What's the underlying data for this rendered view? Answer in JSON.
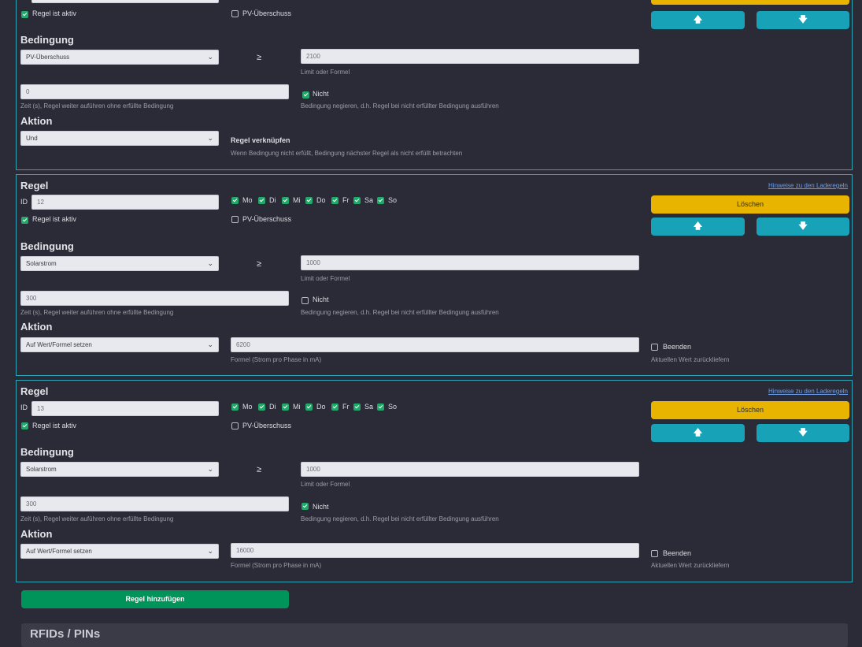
{
  "labels": {
    "rule_heading": "Regel",
    "id_label": "ID",
    "rule_active": "Regel ist aktiv",
    "pv_surplus": "PV-Überschuss",
    "condition_heading": "Bedingung",
    "operator": "≥",
    "limit_hint": "Limit oder Formel",
    "time_hint": "Zeit (s), Regel weiter auführen ohne erfüllte Bedingung",
    "negate_label": "Nicht",
    "negate_hint": "Bedingung negieren, d.h. Regel bei nicht erfüllter Bedingung ausführen",
    "action_heading": "Aktion",
    "link_rules": "Regel verknüpfen",
    "link_rules_hint": "Wenn Bedingung nicht erfüllt, Bedingung nächster Regel als nicht erfüllt betrachten",
    "formula_hint": "Formel (Strom pro Phase in mA)",
    "finish_label": "Beenden",
    "finish_hint": "Aktuellen Wert zurückliefern",
    "delete": "Löschen",
    "help_link": "Hinweise zu den Laderegeln",
    "add_rule": "Regel hinzufügen",
    "section_title": "RFIDs / PINs",
    "arrow_up": "🡅",
    "arrow_down": "🡇"
  },
  "days": [
    "Mo",
    "Di",
    "Mi",
    "Do",
    "Fr",
    "Sa",
    "So"
  ],
  "rule1": {
    "active": true,
    "pv_surplus": false,
    "condition": "PV-Überschuss",
    "limit": "2100",
    "time": "0",
    "negate": true,
    "action": "Und"
  },
  "rule2": {
    "id": "12",
    "active": true,
    "pv_surplus": false,
    "days_checked": [
      true,
      true,
      true,
      true,
      true,
      true,
      true
    ],
    "condition": "Solarstrom",
    "limit": "1000",
    "time": "300",
    "negate": false,
    "action": "Auf Wert/Formel setzen",
    "formula": "6200",
    "finish": false
  },
  "rule3": {
    "id": "13",
    "active": true,
    "pv_surplus": false,
    "days_checked": [
      true,
      true,
      true,
      true,
      true,
      true,
      true
    ],
    "condition": "Solarstrom",
    "limit": "1000",
    "time": "300",
    "negate": true,
    "action": "Auf Wert/Formel setzen",
    "formula": "16000",
    "finish": false
  },
  "colors": {
    "background": "#2a2b36",
    "panel_border": "#2ea6b8",
    "checkbox_on": "#21a96b",
    "delete_button": "#e8b400",
    "move_button": "#17a2b8",
    "add_button": "#00935a",
    "link": "#6c9de8"
  }
}
